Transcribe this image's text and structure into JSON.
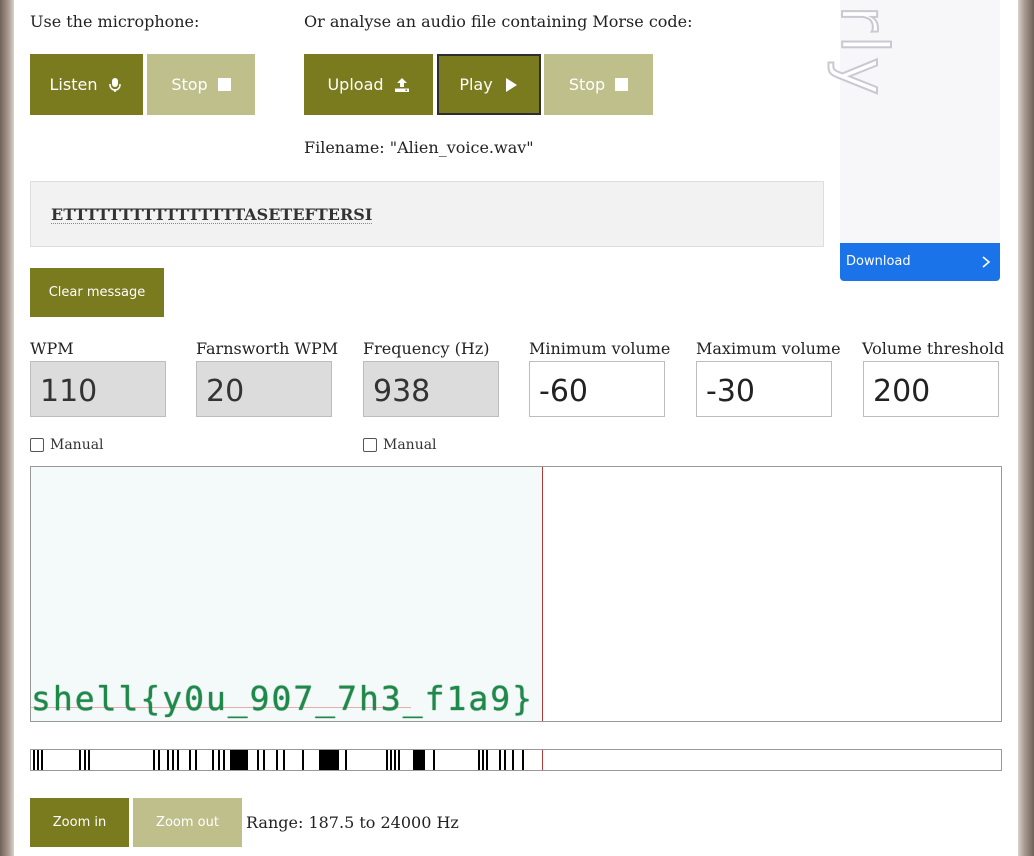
{
  "mic": {
    "label": "Use the microphone:",
    "listen_label": "Listen",
    "stop_label": "Stop"
  },
  "file": {
    "label": "Or analyse an audio file containing Morse code:",
    "upload_label": "Upload",
    "play_label": "Play",
    "stop_label": "Stop",
    "filename_text": "Filename: \"Alien_voice.wav\""
  },
  "message": {
    "text": "ETTTTTTTTTTTTTTTTASETEFTERSI",
    "clear_label": "Clear message"
  },
  "ad": {
    "word": "arly",
    "download_label": "Download"
  },
  "settings": {
    "wpm": {
      "label": "WPM",
      "value": "110",
      "manual_label": "Manual"
    },
    "farnsworth": {
      "label": "Farnsworth WPM",
      "value": "20"
    },
    "frequency": {
      "label": "Frequency (Hz)",
      "value": "938",
      "manual_label": "Manual"
    },
    "min_volume": {
      "label": "Minimum volume",
      "value": "-60"
    },
    "max_volume": {
      "label": "Maximum volume",
      "value": "-30"
    },
    "threshold": {
      "label": "Volume threshold",
      "value": "200"
    }
  },
  "spectrogram": {
    "hidden_text": "shell{y0u_907_7h3_f1a9}"
  },
  "zoom": {
    "in_label": "Zoom in",
    "out_label": "Zoom out",
    "range_text": "Range: 187.5 to 24000 Hz"
  },
  "colors": {
    "button_dark": "#7a7a1e",
    "button_light": "#bfbf8c",
    "ad_blue": "#1a73e8",
    "spectrogram_text": "#1e8a4a",
    "cursor": "#b23a3a"
  },
  "icons": [
    "microphone-icon",
    "stop-icon",
    "upload-icon",
    "play-icon",
    "chevron-right-icon"
  ]
}
